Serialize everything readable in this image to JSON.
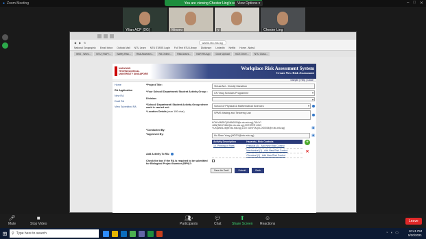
{
  "zoom": {
    "window_title": "Zoom Meeting",
    "share_banner": "You are viewing Chester Ling's screen",
    "view_options": "View Options ▾",
    "participants_tiles": [
      {
        "name": "Yilian ACP (DG)"
      },
      {
        "name": "Minseo"
      },
      {
        "name": "y"
      },
      {
        "name": "Chester Ling"
      }
    ],
    "toolbar": {
      "mute": "Mute",
      "stop_video": "Stop Video",
      "participants": "Participants",
      "participants_count": "4",
      "chat": "Chat",
      "share_screen": "Share Screen",
      "reactions": "Reactions",
      "leave": "Leave"
    }
  },
  "browser": {
    "url": "wams.ntu.edu.sg",
    "bookmarks": [
      "National Geographic",
      "Email Inbox",
      "Outlook Mail",
      "NTU Learn",
      "NTU STARS Login",
      "Full Text NTU Library",
      "Dictionary",
      "LinkedIn",
      "Netflix",
      "Home - NoteA"
    ],
    "open_tabs": [
      "W00 - Work...",
      "NTU | RAP l...",
      "Safety Risk...",
      "Risk Assessm...",
      "RA Online...",
      "Risk Asses...",
      "NUR RA App",
      "Dose Upload",
      "mCS Drive...",
      "NTU Class..."
    ]
  },
  "app": {
    "brand": "NANYANG TECHNOLOGICAL UNIVERSITY SINGAPORE",
    "banner_title": "Workplace Risk Assessment System",
    "banner_sub": "Create New Risk Assessment",
    "help_links": "Sample | Help | Close",
    "nav": [
      "Home",
      "RA Application",
      "New RA",
      "Draft RA",
      "View Submitted RA"
    ],
    "fields": {
      "project_title_label": "*Project Title:",
      "project_title_value": "Virtual Aid - Charity Marathon",
      "school_label": "*Your School/ Department/ Student Activity Group :",
      "school_value": "CN Yang Scholars Programme",
      "division_label": "Division:",
      "division_value": "",
      "work_school_label": "*School/ Department/ Student Activity Group where work is carried out:",
      "work_school_value": "School of Physical & Mathematical Sciences",
      "location_label": "*Location Details",
      "location_hint": "(max 100 char)",
      "location_value": "SPMS Making and Tinkering Lab",
      "conducted_label": "*Conducted By:",
      "conducted_value": "KOH MINSEO(KMIN0009@e.ntu.edu.sg),TAN YI JIAN(TANY0162@e.ntu.edu.sg),CHESTER LING YUX(AW0124@e.ntu.edu.sg),LOO XUNYOU(XLOO0004@e.ntu.edu.sg)",
      "approved_label": "*Approved By:",
      "approved_value": "Ho Shen Yong (HOSY@ntu.edu.sg)",
      "activity_label": "Add Activity To RA:",
      "bpn_label": "Check the box if the RA is required to be submitted for Biological Project Number (BPN)?:"
    },
    "activity_table": {
      "headers": [
        "Activity Description",
        "Hazards | Risk Controls"
      ],
      "activity": "10. Printing of Parts",
      "rows": [
        {
          "hazard": "Physical (3)",
          "control": "Add New Risk Control"
        },
        {
          "hazard": "Mechanical (1)",
          "control": "Add New Risk Control"
        },
        {
          "hazard": "Chemical (1)",
          "control": "Add New Risk Control"
        }
      ]
    },
    "buttons": {
      "save_draft": "Save As Draft",
      "submit": "Submit",
      "back": "Back"
    }
  },
  "taskbar": {
    "search_placeholder": "Type here to search",
    "time": "10:41 PM",
    "date": "5/20/2021"
  }
}
